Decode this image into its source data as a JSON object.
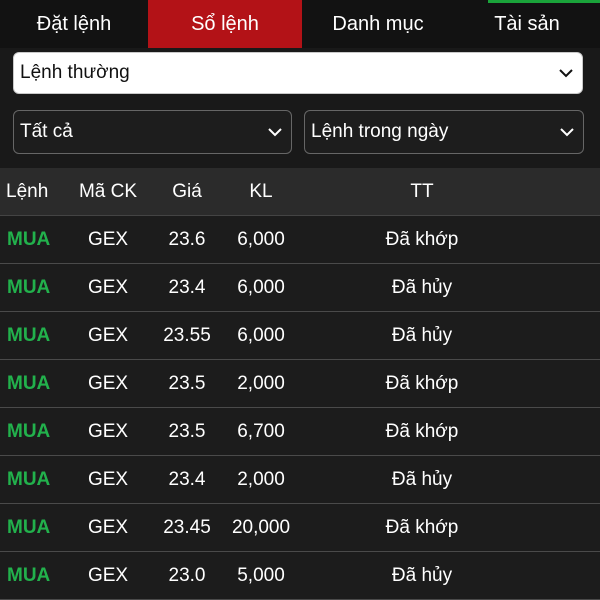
{
  "tabs": [
    {
      "label": "Đặt lệnh"
    },
    {
      "label": "Sổ lệnh"
    },
    {
      "label": "Danh mục"
    },
    {
      "label": "Tài sản"
    }
  ],
  "filters": {
    "order_type": "Lệnh thường",
    "status_filter": "Tất cả",
    "time_filter": "Lệnh trong ngày"
  },
  "table": {
    "headers": {
      "side": "Lệnh",
      "symbol": "Mã CK",
      "price": "Giá",
      "qty": "KL",
      "status": "TT"
    },
    "rows": [
      {
        "side": "MUA",
        "symbol": "GEX",
        "price": "23.6",
        "qty": "6,000",
        "status": "Đã khớp"
      },
      {
        "side": "MUA",
        "symbol": "GEX",
        "price": "23.4",
        "qty": "6,000",
        "status": "Đã hủy"
      },
      {
        "side": "MUA",
        "symbol": "GEX",
        "price": "23.55",
        "qty": "6,000",
        "status": "Đã hủy"
      },
      {
        "side": "MUA",
        "symbol": "GEX",
        "price": "23.5",
        "qty": "2,000",
        "status": "Đã khớp"
      },
      {
        "side": "MUA",
        "symbol": "GEX",
        "price": "23.5",
        "qty": "6,700",
        "status": "Đã khớp"
      },
      {
        "side": "MUA",
        "symbol": "GEX",
        "price": "23.4",
        "qty": "2,000",
        "status": "Đã hủy"
      },
      {
        "side": "MUA",
        "symbol": "GEX",
        "price": "23.45",
        "qty": "20,000",
        "status": "Đã khớp"
      },
      {
        "side": "MUA",
        "symbol": "GEX",
        "price": "23.0",
        "qty": "5,000",
        "status": "Đã hủy"
      }
    ]
  },
  "colors": {
    "active_tab": "#b31217",
    "buy": "#22b14c",
    "accent_bar": "#1aa33a"
  },
  "icons": {
    "dropdown": "chevron-down-icon"
  }
}
